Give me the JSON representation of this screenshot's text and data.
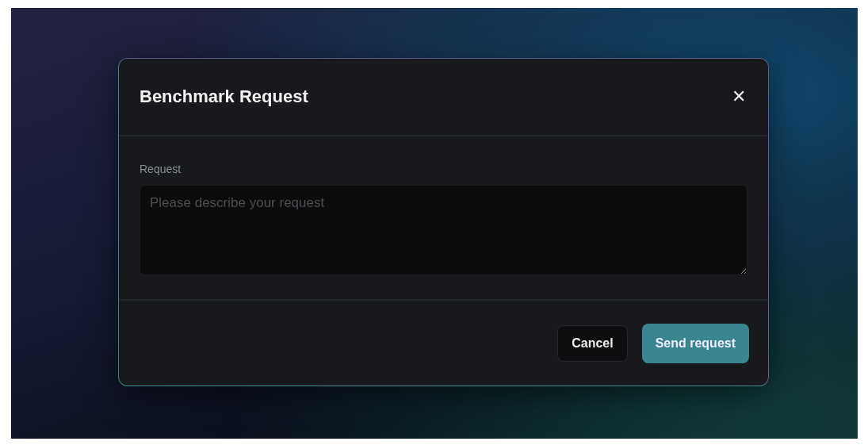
{
  "dialog": {
    "title": "Benchmark Request",
    "close_label": "✕"
  },
  "field": {
    "label": "Request",
    "placeholder": "Please describe your request"
  },
  "buttons": [
    {
      "label": "Cancel",
      "kind": "secondary"
    },
    {
      "label": "Send request",
      "kind": "primary"
    }
  ]
}
